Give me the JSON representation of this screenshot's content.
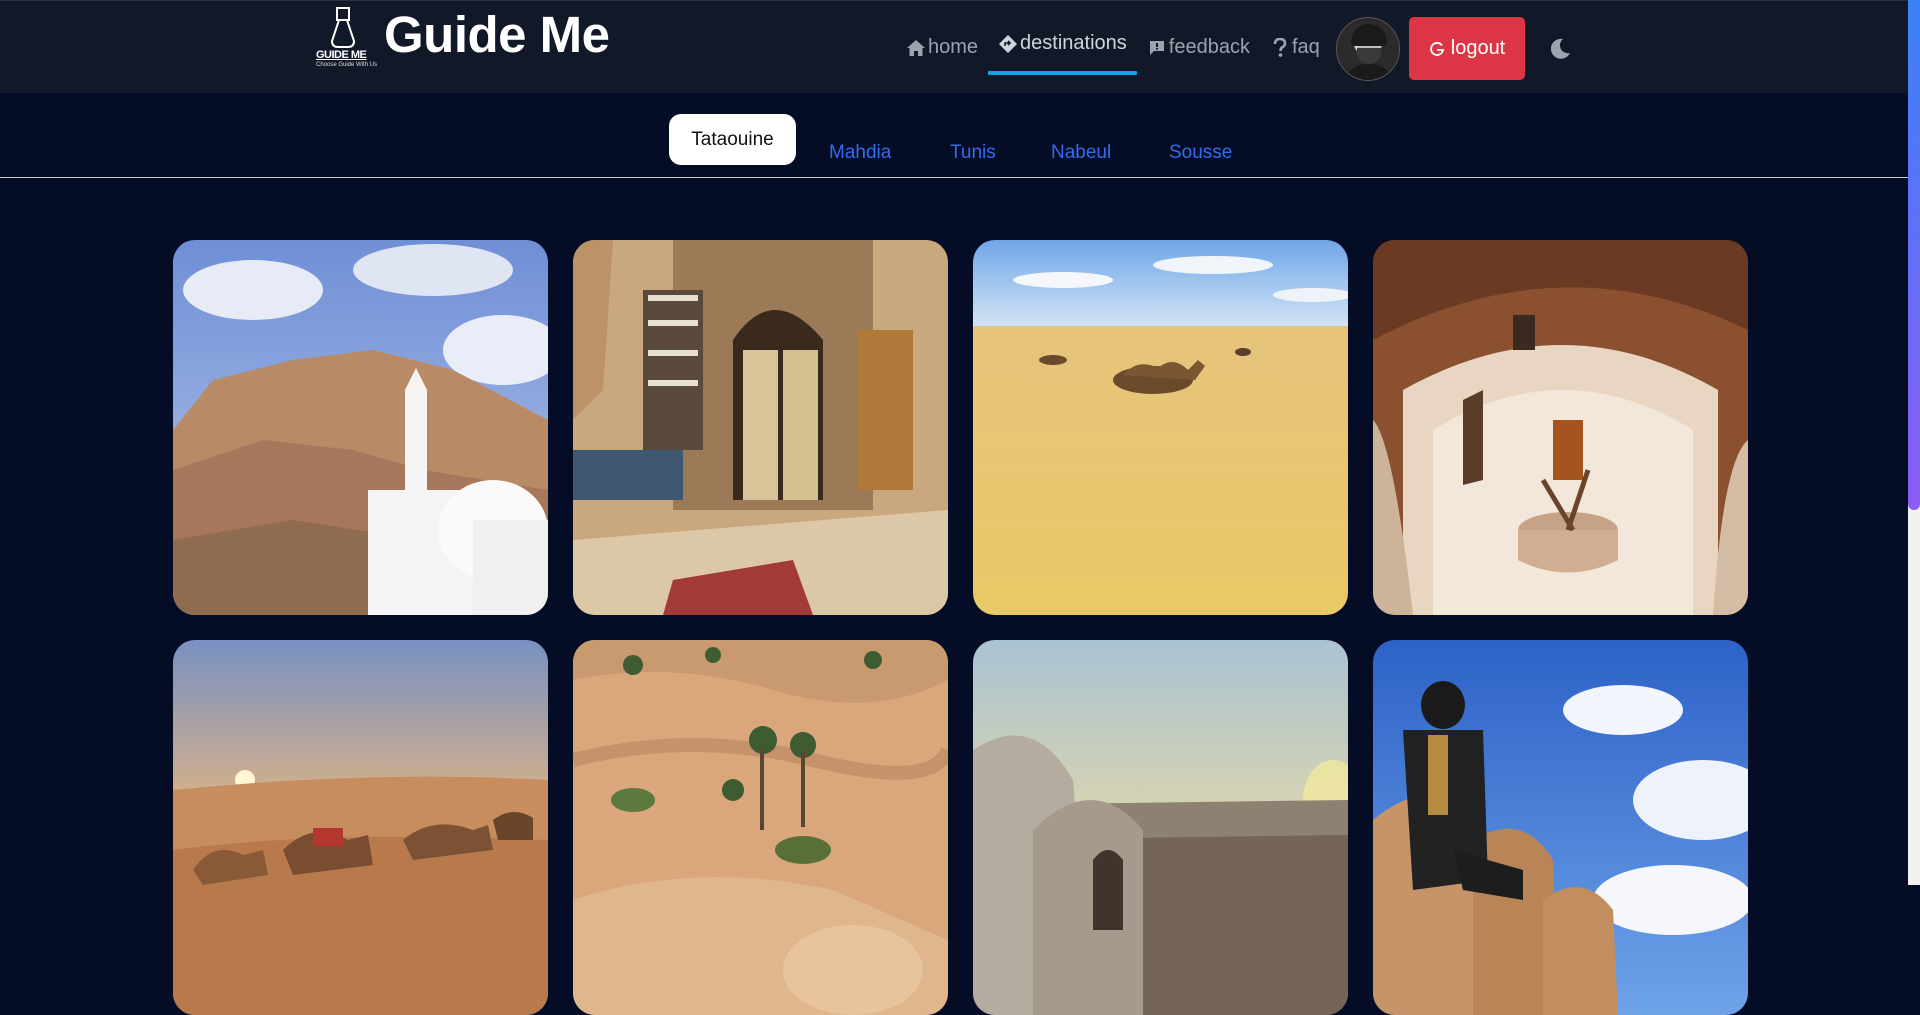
{
  "brand": {
    "title": "Guide Me",
    "logo_text": "GUIDE ME",
    "logo_subtext": "Choose Guide With Us"
  },
  "nav": {
    "items": [
      {
        "label": "home",
        "icon": "home-icon"
      },
      {
        "label": "destinations",
        "icon": "diamond-turn-icon",
        "active": true
      },
      {
        "label": "feedback",
        "icon": "message-icon"
      },
      {
        "label": "faq",
        "icon": "question-icon"
      }
    ],
    "logout_label": "logout",
    "theme_icon": "moon-icon"
  },
  "tabs": [
    {
      "label": "Tataouine",
      "active": true
    },
    {
      "label": "Mahdia"
    },
    {
      "label": "Tunis"
    },
    {
      "label": "Nabeul"
    },
    {
      "label": "Sousse"
    }
  ],
  "gallery": {
    "images": [
      {
        "subject": "mountain village with white mosque"
      },
      {
        "subject": "doorway with hanging rugs"
      },
      {
        "subject": "camels in desert"
      },
      {
        "subject": "troglodyte cave dwelling"
      },
      {
        "subject": "desert sunset with camels"
      },
      {
        "subject": "desert with palm trees"
      },
      {
        "subject": "domed building at dusk"
      },
      {
        "subject": "costumed figure on mud building"
      }
    ]
  },
  "colors": {
    "page_bg": "#050c26",
    "navbar_bg": "#111827",
    "active_underline": "#0ea5e9",
    "logout_bg": "#dc3545",
    "tab_link": "#2f6fed"
  }
}
